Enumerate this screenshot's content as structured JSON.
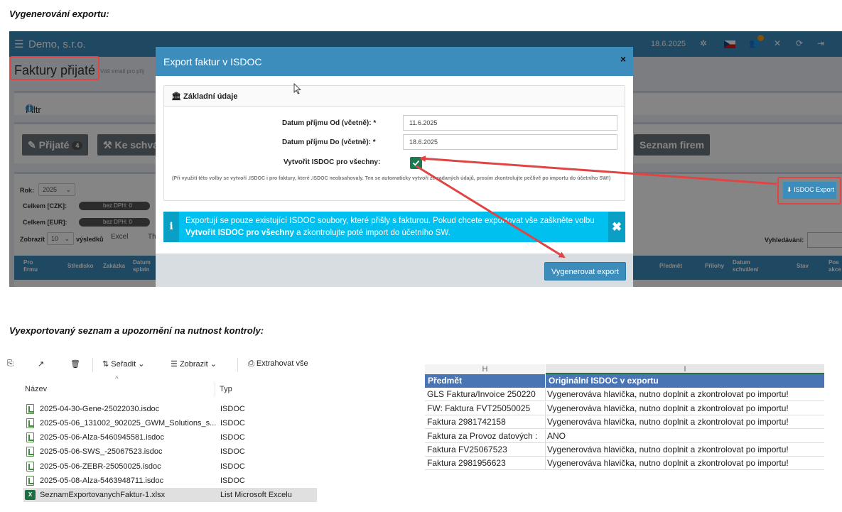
{
  "headings": {
    "generate": "Vygenerování exportu:",
    "exported": "Vyexportovaný seznam a upozornění na nutnost kontroly:"
  },
  "app": {
    "company": "Demo, s.r.o.",
    "date": "18.6.2025",
    "page_title": "Faktury přijaté",
    "page_subtitle": "Váš email pro přij",
    "filter_label": "Filtr",
    "tabs": [
      {
        "label": "Přijaté",
        "count": "4"
      },
      {
        "label": "Ke schvá"
      },
      {
        "label": "Seznam firem"
      }
    ],
    "isdoc_export_label": "ISDOC Export",
    "year_label": "Rok:",
    "year_value": "2025",
    "total_czk_label": "Celkem [CZK]:",
    "total_czk_value": "bez DPH: 0",
    "total_eur_label": "Celkem [EUR]:",
    "total_eur_value": "bez DPH: 0",
    "show_label": "Zobrazit",
    "show_value": "10",
    "show_suffix": "výsledků",
    "excel_label": "Excel",
    "th_label": "Th",
    "search_label": "Vyhledávání:",
    "table_headers": [
      "Pro firmu",
      "Středisko",
      "Zakázka",
      "Datum splatn",
      "Předmět",
      "Přílohy",
      "Datum schválení",
      "Stav",
      "Pos akce"
    ]
  },
  "modal": {
    "title": "Export faktur v ISDOC",
    "close": "×",
    "section_title": "Základní údaje",
    "date_from_label": "Datum příjmu Od (včetně): *",
    "date_from_value": "11.6.2025",
    "date_to_label": "Datum příjmu Do (včetně): *",
    "date_to_value": "18.6.2025",
    "create_all_label": "Vytvořit ISDOC pro všechny:",
    "note": "(Při využití této volby se vytvoří .ISDOC i pro faktury, které .ISDOC neobsahovaly. Ten se automaticky vytvoří ze zadaných údajů, prosím zkontrolujte pečlivě po importu do účetního SW!)",
    "alert_part1": "Exportují se pouze existující ISDOC soubory, které přišly s fakturou. Pokud chcete exportovat vše zaškněte volbu ",
    "alert_bold": "Vytvořit ISDOC pro všechny",
    "alert_part2": " a zkontrolujte poté import do účetního SW.",
    "generate_button": "Vygenerovat export"
  },
  "explorer": {
    "toolbar": {
      "sort": "Seřadit",
      "view": "Zobrazit",
      "extract": "Extrahovat vše"
    },
    "columns": {
      "name": "Název",
      "type": "Typ"
    },
    "files": [
      {
        "name": "2025-04-30-Gene-25022030.isdoc",
        "type": "ISDOC"
      },
      {
        "name": "2025-05-06_131002_902025_GWM_Solutions_s...",
        "type": "ISDOC"
      },
      {
        "name": "2025-05-06-Alza-5460945581.isdoc",
        "type": "ISDOC"
      },
      {
        "name": "2025-05-06-SWS_-25067523.isdoc",
        "type": "ISDOC"
      },
      {
        "name": "2025-05-06-ZEBR-25050025.isdoc",
        "type": "ISDOC"
      },
      {
        "name": "2025-05-08-Alza-5463948711.isdoc",
        "type": "ISDOC"
      },
      {
        "name": "SeznamExportovanychFaktur-1.xlsx",
        "type": "List Microsoft Excelu"
      }
    ]
  },
  "sheet": {
    "col_letters": [
      "H",
      "I"
    ],
    "headers": [
      "Předmět",
      "Originální ISDOC v exportu"
    ],
    "rows": [
      [
        "GLS Faktura/Invoice 250220",
        "Vygenerováva hlavička, nutno doplnit a zkontrolovat po importu!"
      ],
      [
        "FW: Faktura FVT25050025",
        "Vygenerováva hlavička, nutno doplnit a zkontrolovat po importu!"
      ],
      [
        "Faktura 2981742158",
        "Vygenerováva hlavička, nutno doplnit a zkontrolovat po importu!"
      ],
      [
        "Faktura za Provoz datových :",
        "ANO"
      ],
      [
        "Faktura FV25067523",
        "Vygenerováva hlavička, nutno doplnit a zkontrolovat po importu!"
      ],
      [
        "Faktura 2981956623",
        "Vygenerováva hlavička, nutno doplnit a zkontrolovat po importu!"
      ]
    ]
  },
  "colors": {
    "primary": "#3c8dbc",
    "alert": "#00c0ef",
    "annotation": "#e04545",
    "sheet_header": "#4a75b5"
  }
}
